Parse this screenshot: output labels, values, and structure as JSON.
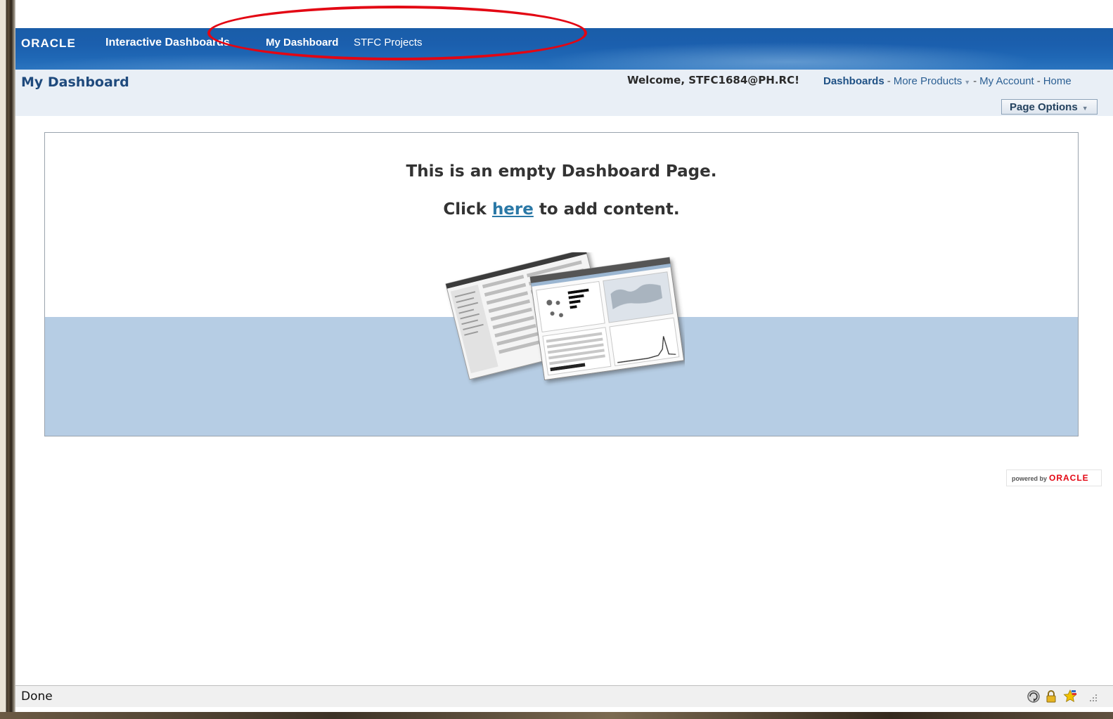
{
  "banner": {
    "logo": "ORACLE",
    "product": "Interactive Dashboards",
    "tabs": [
      {
        "label": "My Dashboard",
        "active": true
      },
      {
        "label": "STFC Projects",
        "active": false
      }
    ]
  },
  "header": {
    "page_title": "My Dashboard",
    "welcome": "Welcome, STFC1684@PH.RC!",
    "links": {
      "dashboards": "Dashboards",
      "more_products": "More Products",
      "my_account": "My Account",
      "home": "Home",
      "sep": "-"
    },
    "page_options": "Page Options"
  },
  "panel": {
    "empty_message": "This is an empty Dashboard Page.",
    "click_prefix": "Click",
    "link_text": "here",
    "click_suffix": "to add content."
  },
  "footer": {
    "powered_by": "powered by",
    "brand": "ORACLE"
  },
  "status": {
    "text": "Done"
  },
  "colors": {
    "banner": "#1b5fae",
    "annotation": "#e30613",
    "header_bg": "#e9eff6",
    "panel_band": "#b6cde4",
    "link": "#2a78a6"
  }
}
